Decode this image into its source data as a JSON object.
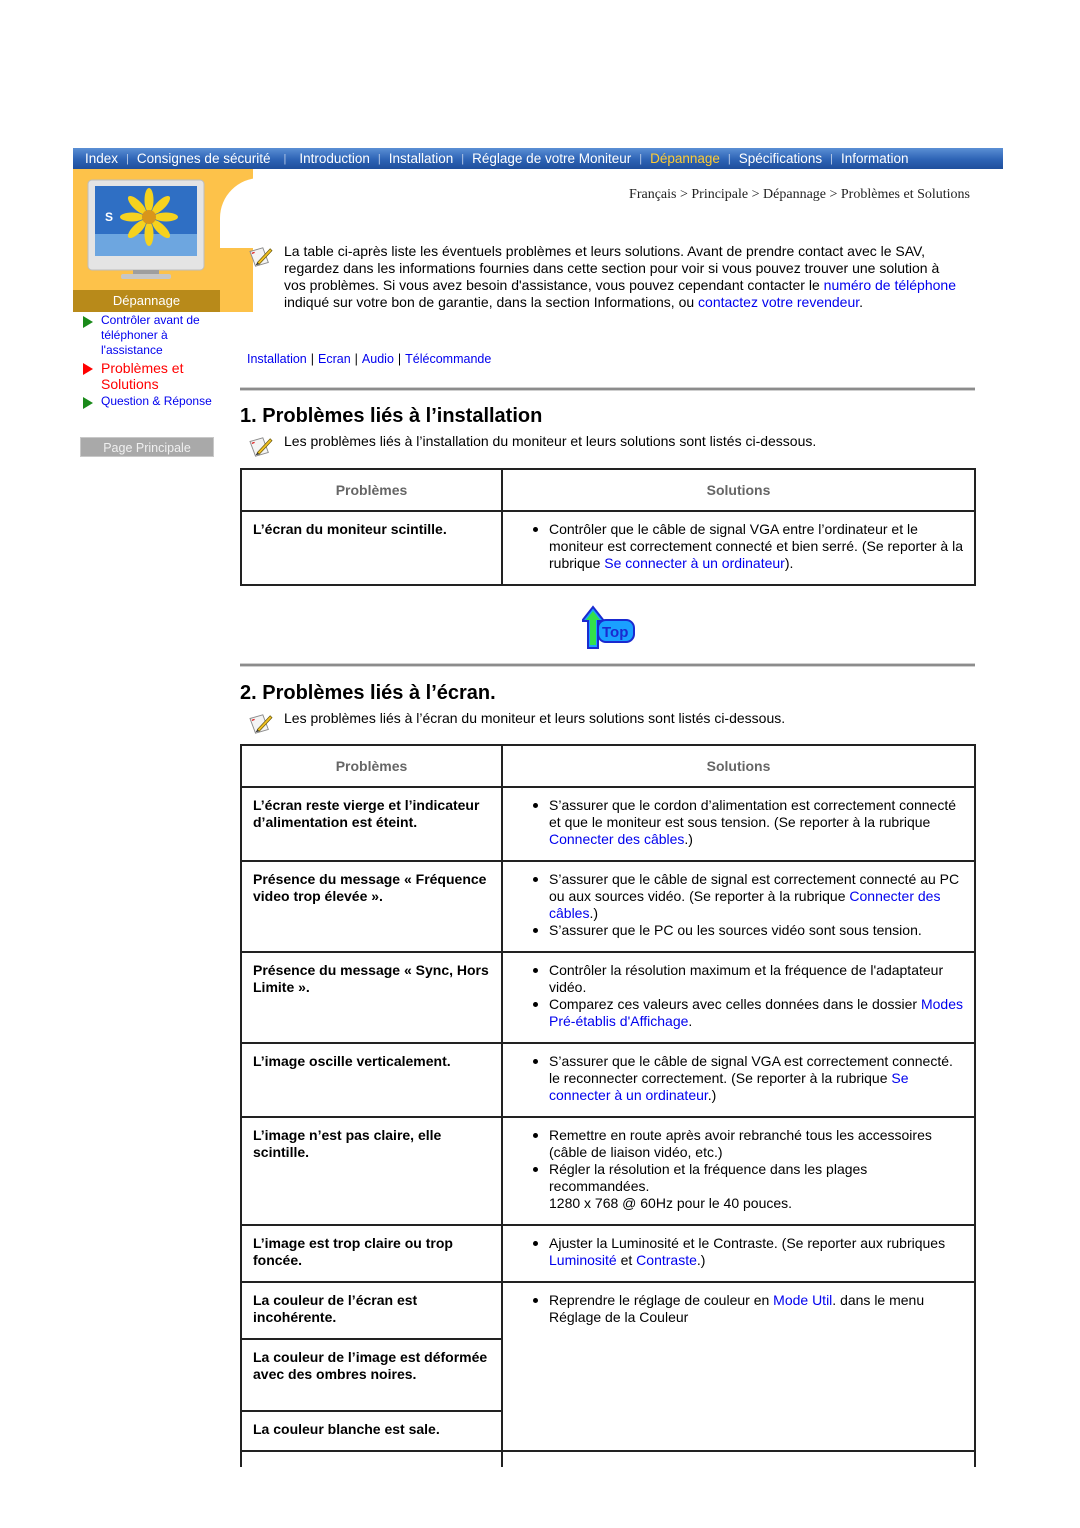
{
  "topnav": {
    "items": [
      {
        "label": "Index",
        "active": false
      },
      {
        "label": "Consignes de sécurité",
        "active": false
      },
      {
        "label": "Introduction",
        "active": false
      },
      {
        "label": "Installation",
        "active": false
      },
      {
        "label": "Réglage de votre Moniteur",
        "active": false
      },
      {
        "label": "Dépannage",
        "active": true
      },
      {
        "label": "Spécifications",
        "active": false
      },
      {
        "label": "Information",
        "active": false
      }
    ],
    "active_color": "#ffcc33"
  },
  "sidebar": {
    "section_label": "Dépannage",
    "items": [
      {
        "label": "Contrôler avant de téléphoner à l'assistance",
        "active": false
      },
      {
        "label": "Problèmes et Solutions",
        "active": true
      },
      {
        "label": "Question & Réponse",
        "active": false
      }
    ],
    "home_button": "Page Principale"
  },
  "breadcrumb": "Français > Principale > Dépannage > Problèmes et Solutions",
  "intro": {
    "text_1": "La table ci-après liste les éventuels problèmes et leurs solutions. Avant de prendre contact avec le SAV, regardez dans les informations fournies dans cette section pour voir si vous pouvez trouver une solution à vos problèmes. Si vous avez besoin d'assistance, vous pouvez cependant contacter le ",
    "link_1": "numéro de téléphone",
    "text_2": " indiqué sur votre bon de garantie, dans la section Informations, ou ",
    "link_2": "contactez votre revendeur",
    "text_3": "."
  },
  "quicklinks": [
    "Installation",
    "Ecran",
    "Audio",
    "Télécommande"
  ],
  "sections": [
    {
      "title": "1. Problèmes liés à l’installation",
      "note": "Les problèmes liés à l’installation du moniteur et leurs solutions sont listés ci-dessous.",
      "header_problem": "Problèmes",
      "header_solution": "Solutions",
      "rows": [
        {
          "problem": "L’écran du moniteur scintille.",
          "s1_a": "Contrôler que le câble de signal VGA entre l’ordinateur et le moniteur est correctement connecté et bien serré. (Se reporter à la rubrique ",
          "s1_link": "Se connecter à un ordinateur",
          "s1_b": ")."
        }
      ]
    },
    {
      "title": "2. Problèmes liés à l’écran.",
      "note": "Les problèmes liés à l’écran du moniteur et leurs solutions sont listés ci-dessous.",
      "header_problem": "Problèmes",
      "header_solution": "Solutions",
      "rows": [
        {
          "problem": "L’écran reste vierge et l’indicateur d’alimentation est éteint.",
          "s1_a": "S’assurer que le cordon d’alimentation est correctement connecté et que le moniteur est sous tension. (Se reporter à la rubrique ",
          "s1_link": "Connecter des câbles",
          "s1_b": ".)"
        },
        {
          "problem": "Présence du message « Fréquence video trop élevée ».",
          "s1_a": "S’assurer que le câble de signal est correctement connecté au PC ou aux sources vidéo. (Se reporter à la rubrique ",
          "s1_link": "Connecter des câbles",
          "s1_b": ".)",
          "s2": "S’assurer que le PC ou les sources vidéo sont sous tension."
        },
        {
          "problem": "Présence du message « Sync, Hors Limite ».",
          "s1_a": "Contrôler la résolution maximum et la fréquence de l'adaptateur vidéo.",
          "s2_a": "Comparez ces valeurs avec celles données dans le dossier ",
          "s2_link": "Modes Pré-établis d'Affichage",
          "s2_b": "."
        },
        {
          "problem": "L’image oscille verticalement.",
          "s1_a": "S’assurer que le câble de signal VGA est correctement connecté. le reconnecter correctement. (Se reporter à la rubrique ",
          "s1_link": "Se connecter à un ordinateur",
          "s1_b": ".)"
        },
        {
          "problem": "L’image n’est pas claire, elle scintille.",
          "s1_a": "Remettre en route après avoir rebranché tous les accessoires (câble de liaison vidéo, etc.)",
          "s2_a": "Régler la résolution et la fréquence dans les plages recommandées.",
          "s2_extra": "1280 x 768 @ 60Hz pour le 40 pouces."
        },
        {
          "problem": "L’image est trop claire ou trop foncée.",
          "s1_a": "Ajuster la Luminosité et le Contraste. (Se reporter aux rubriques ",
          "s1_link": "Luminosité",
          "s1_mid": " et ",
          "s1_link2": "Contraste",
          "s1_b": ".)"
        },
        {
          "problem": "La couleur de l’écran est incohérente.",
          "s1_a": "Reprendre le réglage de couleur en ",
          "s1_link": "Mode Util",
          "s1_b": ". dans le menu Réglage de la Couleur"
        },
        {
          "problem": "La couleur de l’image est déformée avec des ombres noires."
        },
        {
          "problem": "La couleur blanche est sale."
        }
      ]
    }
  ],
  "top_button": {
    "label": "Top"
  }
}
